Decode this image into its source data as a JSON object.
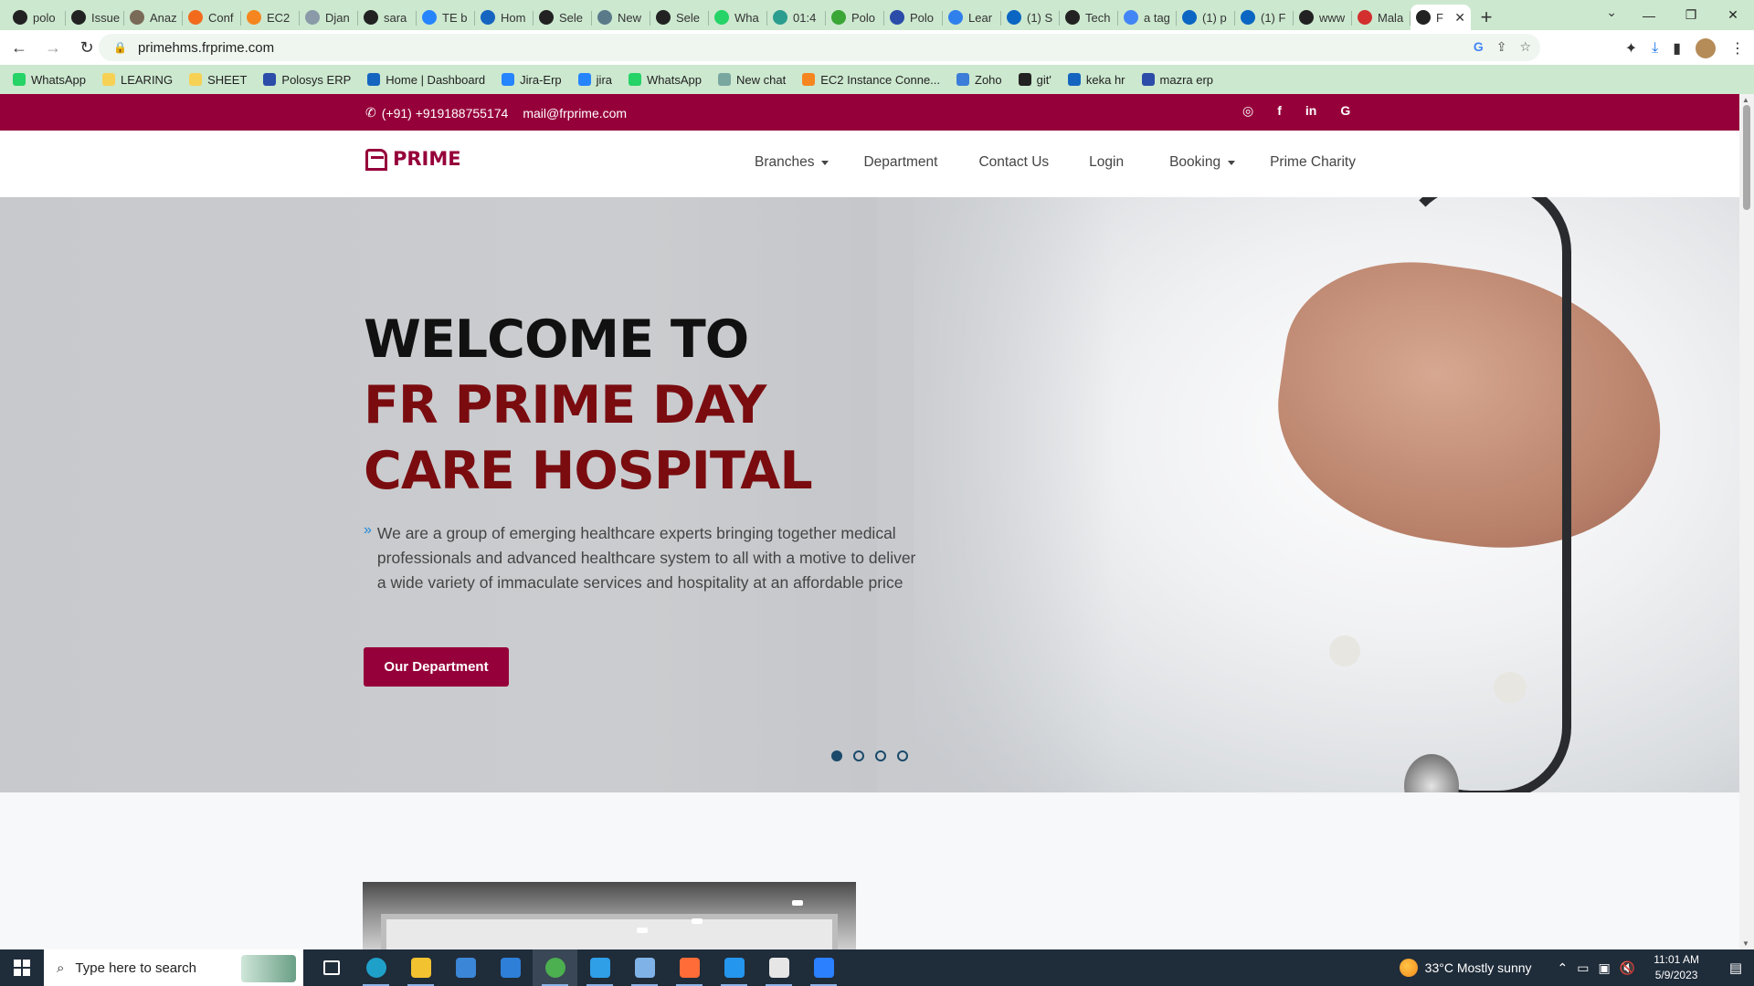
{
  "browser": {
    "tabs": [
      {
        "label": "polo",
        "icon": "github-icon",
        "color": "#222222"
      },
      {
        "label": "Issue",
        "icon": "github-icon",
        "color": "#222222"
      },
      {
        "label": "Anaz",
        "icon": "person-icon",
        "color": "#7a6a58"
      },
      {
        "label": "Conf",
        "icon": "confluence-icon",
        "color": "#f26b1d"
      },
      {
        "label": "EC2",
        "icon": "aws-icon",
        "color": "#f5861f"
      },
      {
        "label": "Djan",
        "icon": "globe-icon",
        "color": "#8a9aa8"
      },
      {
        "label": "sara",
        "icon": "chatgpt-icon",
        "color": "#222222"
      },
      {
        "label": "TE b",
        "icon": "jira-icon",
        "color": "#2684ff"
      },
      {
        "label": "Hom",
        "icon": "keka-icon",
        "color": "#1565c0"
      },
      {
        "label": "Sele",
        "icon": "chatgpt-icon",
        "color": "#222222"
      },
      {
        "label": "New",
        "icon": "chat-icon",
        "color": "#5a7a8a"
      },
      {
        "label": "Sele",
        "icon": "chatgpt-icon",
        "color": "#222222"
      },
      {
        "label": "Wha",
        "icon": "whatsapp-icon",
        "color": "#25d366"
      },
      {
        "label": "01:4",
        "icon": "timer-icon",
        "color": "#2a9d8f"
      },
      {
        "label": "Polo",
        "icon": "polosys-icon",
        "color": "#3aa635"
      },
      {
        "label": "Polo",
        "icon": "polosys-icon",
        "color": "#2b4ca8"
      },
      {
        "label": "Lear",
        "icon": "bird-icon",
        "color": "#2f80ed"
      },
      {
        "label": "(1) S",
        "icon": "linkedin-icon",
        "color": "#0a66c2"
      },
      {
        "label": "Tech",
        "icon": "chatgpt-icon",
        "color": "#222222"
      },
      {
        "label": "a tag",
        "icon": "google-icon",
        "color": "#4285f4"
      },
      {
        "label": "(1) p",
        "icon": "linkedin-icon",
        "color": "#0a66c2"
      },
      {
        "label": "(1) F",
        "icon": "linkedin-icon",
        "color": "#0a66c2"
      },
      {
        "label": "www",
        "icon": "chatgpt-icon",
        "color": "#222222"
      },
      {
        "label": "Mala",
        "icon": "malayalam-icon",
        "color": "#d32f2f"
      },
      {
        "label": "F",
        "icon": "chatgpt-icon",
        "color": "#222222",
        "active": true
      }
    ],
    "url": "primehms.frprime.com",
    "bookmarks": [
      {
        "label": "WhatsApp",
        "color": "#25d366"
      },
      {
        "label": "LEARING",
        "color": "#f7d154"
      },
      {
        "label": "SHEET",
        "color": "#f7d154"
      },
      {
        "label": "Polosys ERP",
        "color": "#2b4ca8"
      },
      {
        "label": "Home | Dashboard",
        "color": "#1565c0"
      },
      {
        "label": "Jira-Erp",
        "color": "#2684ff"
      },
      {
        "label": "jira",
        "color": "#2684ff"
      },
      {
        "label": "WhatsApp",
        "color": "#25d366"
      },
      {
        "label": "New chat",
        "color": "#7aa6a0"
      },
      {
        "label": "EC2 Instance Conne...",
        "color": "#f5861f"
      },
      {
        "label": "Zoho",
        "color": "#3b7dd8"
      },
      {
        "label": "git'",
        "color": "#222222"
      },
      {
        "label": "keka hr",
        "color": "#1565c0"
      },
      {
        "label": "mazra erp",
        "color": "#2b4ca8"
      }
    ]
  },
  "site": {
    "phone": "(+91) +919188755174",
    "email": "mail@frprime.com",
    "social": [
      "instagram-icon",
      "facebook-icon",
      "linkedin-icon",
      "google-icon"
    ],
    "brand": "PRIME",
    "brand_color": "#96003a",
    "menu": [
      {
        "label": "Branches",
        "dropdown": true
      },
      {
        "label": "Department",
        "dropdown": false
      },
      {
        "label": "Contact Us",
        "dropdown": false
      },
      {
        "label": "Login",
        "dropdown": false
      },
      {
        "label": "Booking",
        "dropdown": true
      },
      {
        "label": "Prime Charity",
        "dropdown": false
      }
    ],
    "hero": {
      "title_line1": "WELCOME TO",
      "title_line2": "FR PRIME DAY CARE HOSPITAL",
      "description": "We are a group of emerging healthcare experts bringing together medical professionals and advanced healthcare system to all with a motive to deliver a wide variety of immaculate services and hospitality at an affordable price",
      "cta": "Our Department",
      "slides": 4,
      "active_slide": 1
    }
  },
  "taskbar": {
    "search_placeholder": "Type here to search",
    "apps": [
      {
        "name": "task-view",
        "color": "#ffffff"
      },
      {
        "name": "edge",
        "color": "#1fa0c9"
      },
      {
        "name": "file-explorer",
        "color": "#f2c230"
      },
      {
        "name": "store",
        "color": "#3b86d6"
      },
      {
        "name": "mail",
        "color": "#2d7fd8"
      },
      {
        "name": "chrome",
        "color": "#4caf50"
      },
      {
        "name": "vscode",
        "color": "#2f9fe8"
      },
      {
        "name": "notes",
        "color": "#7fb3e8"
      },
      {
        "name": "postman",
        "color": "#ff6c37"
      },
      {
        "name": "docker",
        "color": "#2496ed"
      },
      {
        "name": "slack",
        "color": "#e6e6e6"
      },
      {
        "name": "calendar",
        "color": "#2b80ff"
      }
    ],
    "weather": "33°C  Mostly sunny",
    "time": "11:01 AM",
    "date": "5/9/2023"
  }
}
